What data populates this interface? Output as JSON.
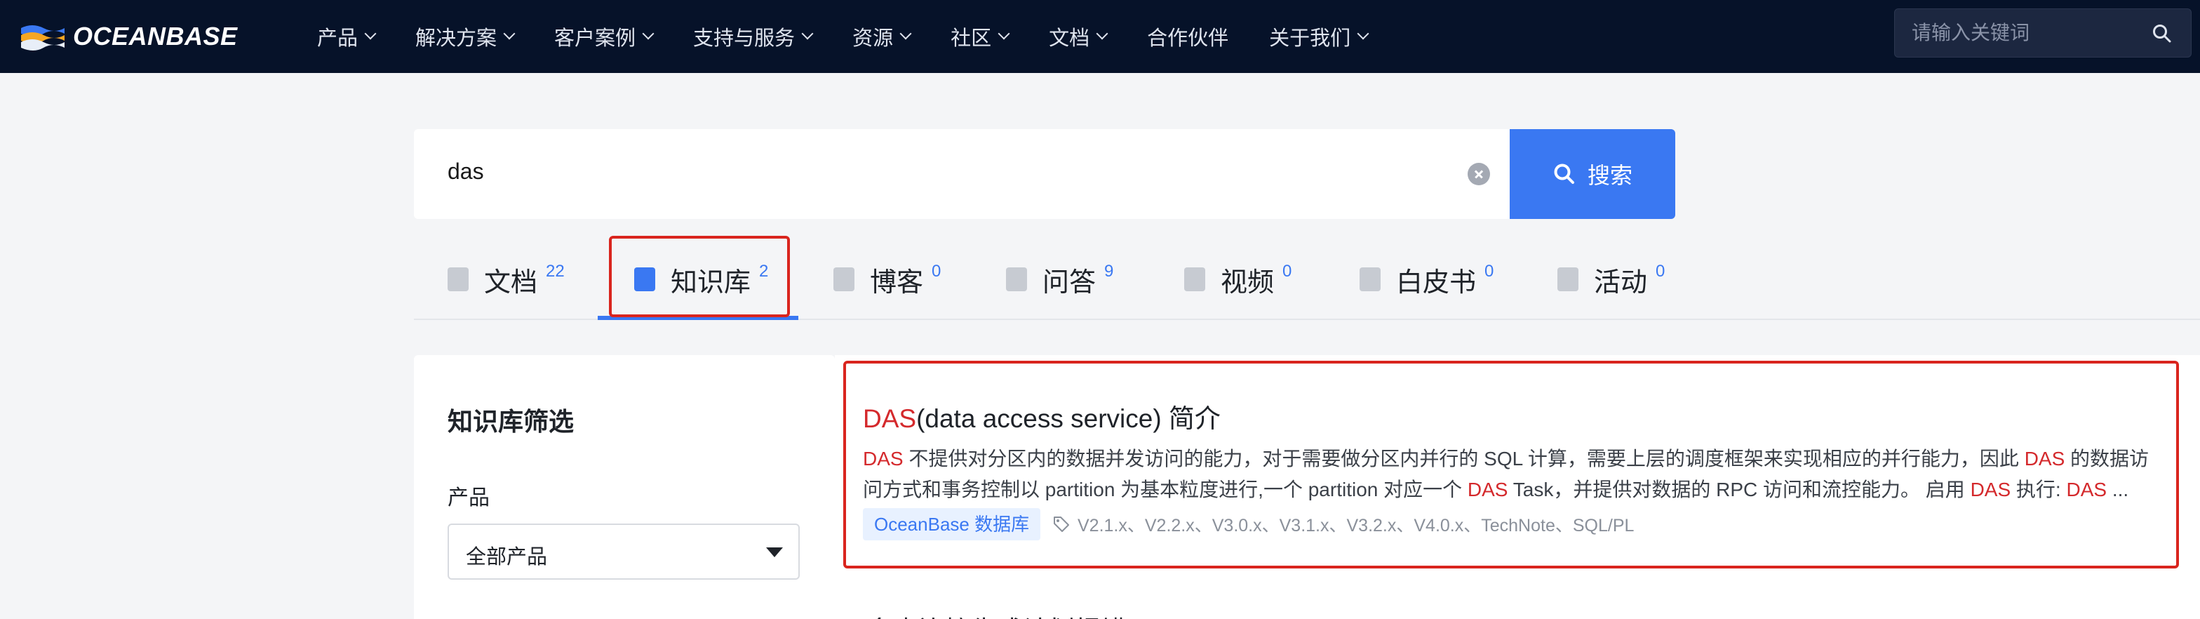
{
  "brand": {
    "name": "OCEANBASE"
  },
  "nav": {
    "items": [
      {
        "label": "产品",
        "dropdown": true
      },
      {
        "label": "解决方案",
        "dropdown": true
      },
      {
        "label": "客户案例",
        "dropdown": true
      },
      {
        "label": "支持与服务",
        "dropdown": true
      },
      {
        "label": "资源",
        "dropdown": true
      },
      {
        "label": "社区",
        "dropdown": true
      },
      {
        "label": "文档",
        "dropdown": true
      },
      {
        "label": "合作伙伴",
        "dropdown": false
      },
      {
        "label": "关于我们",
        "dropdown": true
      }
    ],
    "search_placeholder": "请输入关键词"
  },
  "search": {
    "value": "das",
    "button_label": "搜索"
  },
  "tabs": [
    {
      "label": "文档",
      "count": "22",
      "icon": "doc-icon"
    },
    {
      "label": "知识库",
      "count": "2",
      "icon": "knowledge-icon",
      "active": true
    },
    {
      "label": "博客",
      "count": "0",
      "icon": "blog-icon"
    },
    {
      "label": "问答",
      "count": "9",
      "icon": "qa-icon"
    },
    {
      "label": "视频",
      "count": "0",
      "icon": "video-icon"
    },
    {
      "label": "白皮书",
      "count": "0",
      "icon": "whitepaper-icon"
    },
    {
      "label": "活动",
      "count": "0",
      "icon": "event-icon"
    }
  ],
  "filter": {
    "title": "知识库筛选",
    "product_label": "产品",
    "product_value": "全部产品"
  },
  "results": [
    {
      "title_hl": "DAS",
      "title_rest": "(data access service) 简介",
      "desc_line1_parts": [
        {
          "t": "DAS",
          "hl": true
        },
        {
          "t": " 不提供对分区内的数据并发访问的能力，对于需要做分区内并行的 SQL 计算，需要上层的调度框架来实现相应的并行能力，因此 ",
          "hl": false
        },
        {
          "t": "DAS",
          "hl": true
        },
        {
          "t": " 的数据访",
          "hl": false
        }
      ],
      "desc_line2_parts": [
        {
          "t": "问方式和事务控制以 partition 为基本粒度进行,一个 partition 对应一个 ",
          "hl": false
        },
        {
          "t": "DAS",
          "hl": true
        },
        {
          "t": " Task，并提供对数据的 RPC 访问和流控能力。 启用 ",
          "hl": false
        },
        {
          "t": "DAS",
          "hl": true
        },
        {
          "t": " 执行: ",
          "hl": false
        },
        {
          "t": "DAS",
          "hl": true
        },
        {
          "t": " ...",
          "hl": false
        }
      ],
      "tag": "OceanBase 数据库",
      "versions": "V2.1.x、V2.2.x、V3.0.x、V3.1.x、V3.2.x、V4.0.x、TechNote、SQL/PL"
    }
  ],
  "next_result_title": "多表连接生成计划报错..."
}
